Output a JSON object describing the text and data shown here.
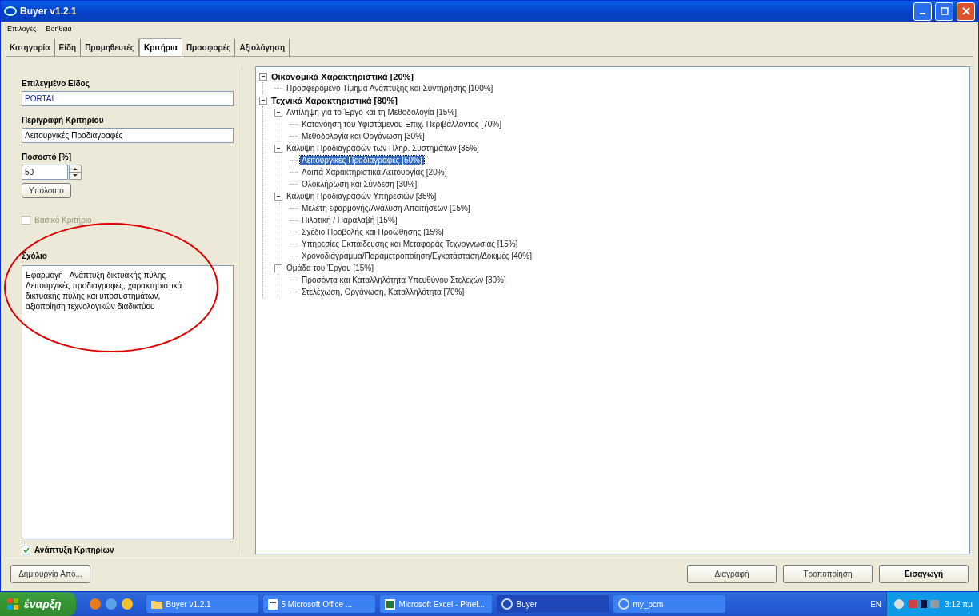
{
  "window": {
    "title": "Buyer v1.2.1"
  },
  "menu": [
    "Επιλογές",
    "Βοήθεια"
  ],
  "tabs": [
    {
      "label": "Κατηγορία",
      "selected": false
    },
    {
      "label": "Είδη",
      "selected": false
    },
    {
      "label": "Προμηθευτές",
      "selected": false
    },
    {
      "label": "Κριτήρια",
      "selected": true
    },
    {
      "label": "Προσφορές",
      "selected": false
    },
    {
      "label": "Αξιολόγηση",
      "selected": false
    }
  ],
  "form": {
    "item_label": "Επιλεγμένο Είδος",
    "item_value": "PORTAL",
    "description_label": "Περιγραφή Κριτηρίου",
    "description_value": "Λειτουργικές Προδιαγραφές",
    "percent_label": "Ποσοστό [%]",
    "percent_value": "50",
    "remainder_button": "Υπόλοιπο",
    "basic_checkbox": {
      "label": "Βασικό Κριτήριο",
      "checked": false,
      "disabled": true
    },
    "comment_label": "Σχόλιο",
    "comment_value": "Εφαρμογή - Ανάπτυξη  δικτυακής πύλης - Λειτουργικές προδιαγραφές, χαρακτηριστικά δικτυακής πύλης και υποσυστημάτων, αξιοποίηση τεχνολογικών διαδικτύου",
    "expand_checkbox": {
      "label": "Ανάπτυξη Κριτηρίων",
      "checked": true,
      "disabled": false
    }
  },
  "tree": [
    {
      "label": "Οικονομικά Χαρακτηριστικά [20%]",
      "expanded": true,
      "selected": false,
      "children": [
        {
          "label": "Προσφερόμενο Τίμημα Ανάπτυξης και Συντήρησης [100%]",
          "selected": false
        }
      ]
    },
    {
      "label": "Τεχνικά Χαρακτηριστικά [80%]",
      "expanded": true,
      "selected": false,
      "children": [
        {
          "label": "Αντίληψη για το Έργο και τη Μεθοδολογία [15%]",
          "expanded": true,
          "selected": false,
          "children": [
            {
              "label": "Κατανόηση του Υφιστάμενου Επιχ. Περιβάλλοντος [70%]",
              "selected": false
            },
            {
              "label": "Μεθοδολογία και Οργάνωση [30%]",
              "selected": false
            }
          ]
        },
        {
          "label": "Κάλυψη Προδιαγραφών των Πληρ. Συστημάτων [35%]",
          "expanded": true,
          "selected": false,
          "children": [
            {
              "label": "Λειτουργικές Προδιαγραφές [50%]",
              "selected": true
            },
            {
              "label": "Λοιπά Χαρακτηριστικά Λειτουργίας [20%]",
              "selected": false
            },
            {
              "label": "Ολοκλήρωση και Σύνδεση [30%]",
              "selected": false
            }
          ]
        },
        {
          "label": "Κάλυψη Προδιαγραφών Υπηρεσιών [35%]",
          "expanded": true,
          "selected": false,
          "children": [
            {
              "label": "Μελέτη εφαρμογής/Ανάλυση Απαιτήσεων [15%]",
              "selected": false
            },
            {
              "label": "Πιλοτική / Παραλαβή [15%]",
              "selected": false
            },
            {
              "label": "Σχέδιο Προβολής και Προώθησης [15%]",
              "selected": false
            },
            {
              "label": "Υπηρεσίες Εκπαίδευσης και Μεταφοράς Τεχνογνωσίας [15%]",
              "selected": false
            },
            {
              "label": "Χρονοδιάγραμμα/Παραμετροποίηση/Εγκατάσταση/Δοκιμές [40%]",
              "selected": false
            }
          ]
        },
        {
          "label": "Ομάδα του Έργου [15%]",
          "expanded": true,
          "selected": false,
          "children": [
            {
              "label": "Προσόντα και Καταλληλότητα Υπευθύνου Στελεχών [30%]",
              "selected": false
            },
            {
              "label": "Στελέχωση, Οργάνωση, Καταλληλότητα [70%]",
              "selected": false
            }
          ]
        }
      ]
    }
  ],
  "bottom_buttons": [
    {
      "label": "Δημιουργία Από...",
      "kind": "left",
      "bold": false
    },
    {
      "label": "Διαγραφή",
      "kind": "right",
      "bold": false
    },
    {
      "label": "Τροποποίηση",
      "kind": "right",
      "bold": false
    },
    {
      "label": "Εισαγωγή",
      "kind": "right",
      "bold": true
    }
  ],
  "taskbar": {
    "start": "έναρξη",
    "tasks": [
      {
        "label": "Buyer v1.2.1",
        "kind": "folder",
        "selected": false
      },
      {
        "label": "5 Microsoft Office ...",
        "kind": "group",
        "selected": false
      },
      {
        "label": "Microsoft Excel - Pinel...",
        "kind": "excel",
        "selected": false
      },
      {
        "label": "Buyer",
        "kind": "app",
        "selected": true
      },
      {
        "label": "my_pcm",
        "kind": "app",
        "selected": false
      }
    ],
    "language": "EN",
    "clock": "3:12 πμ"
  }
}
